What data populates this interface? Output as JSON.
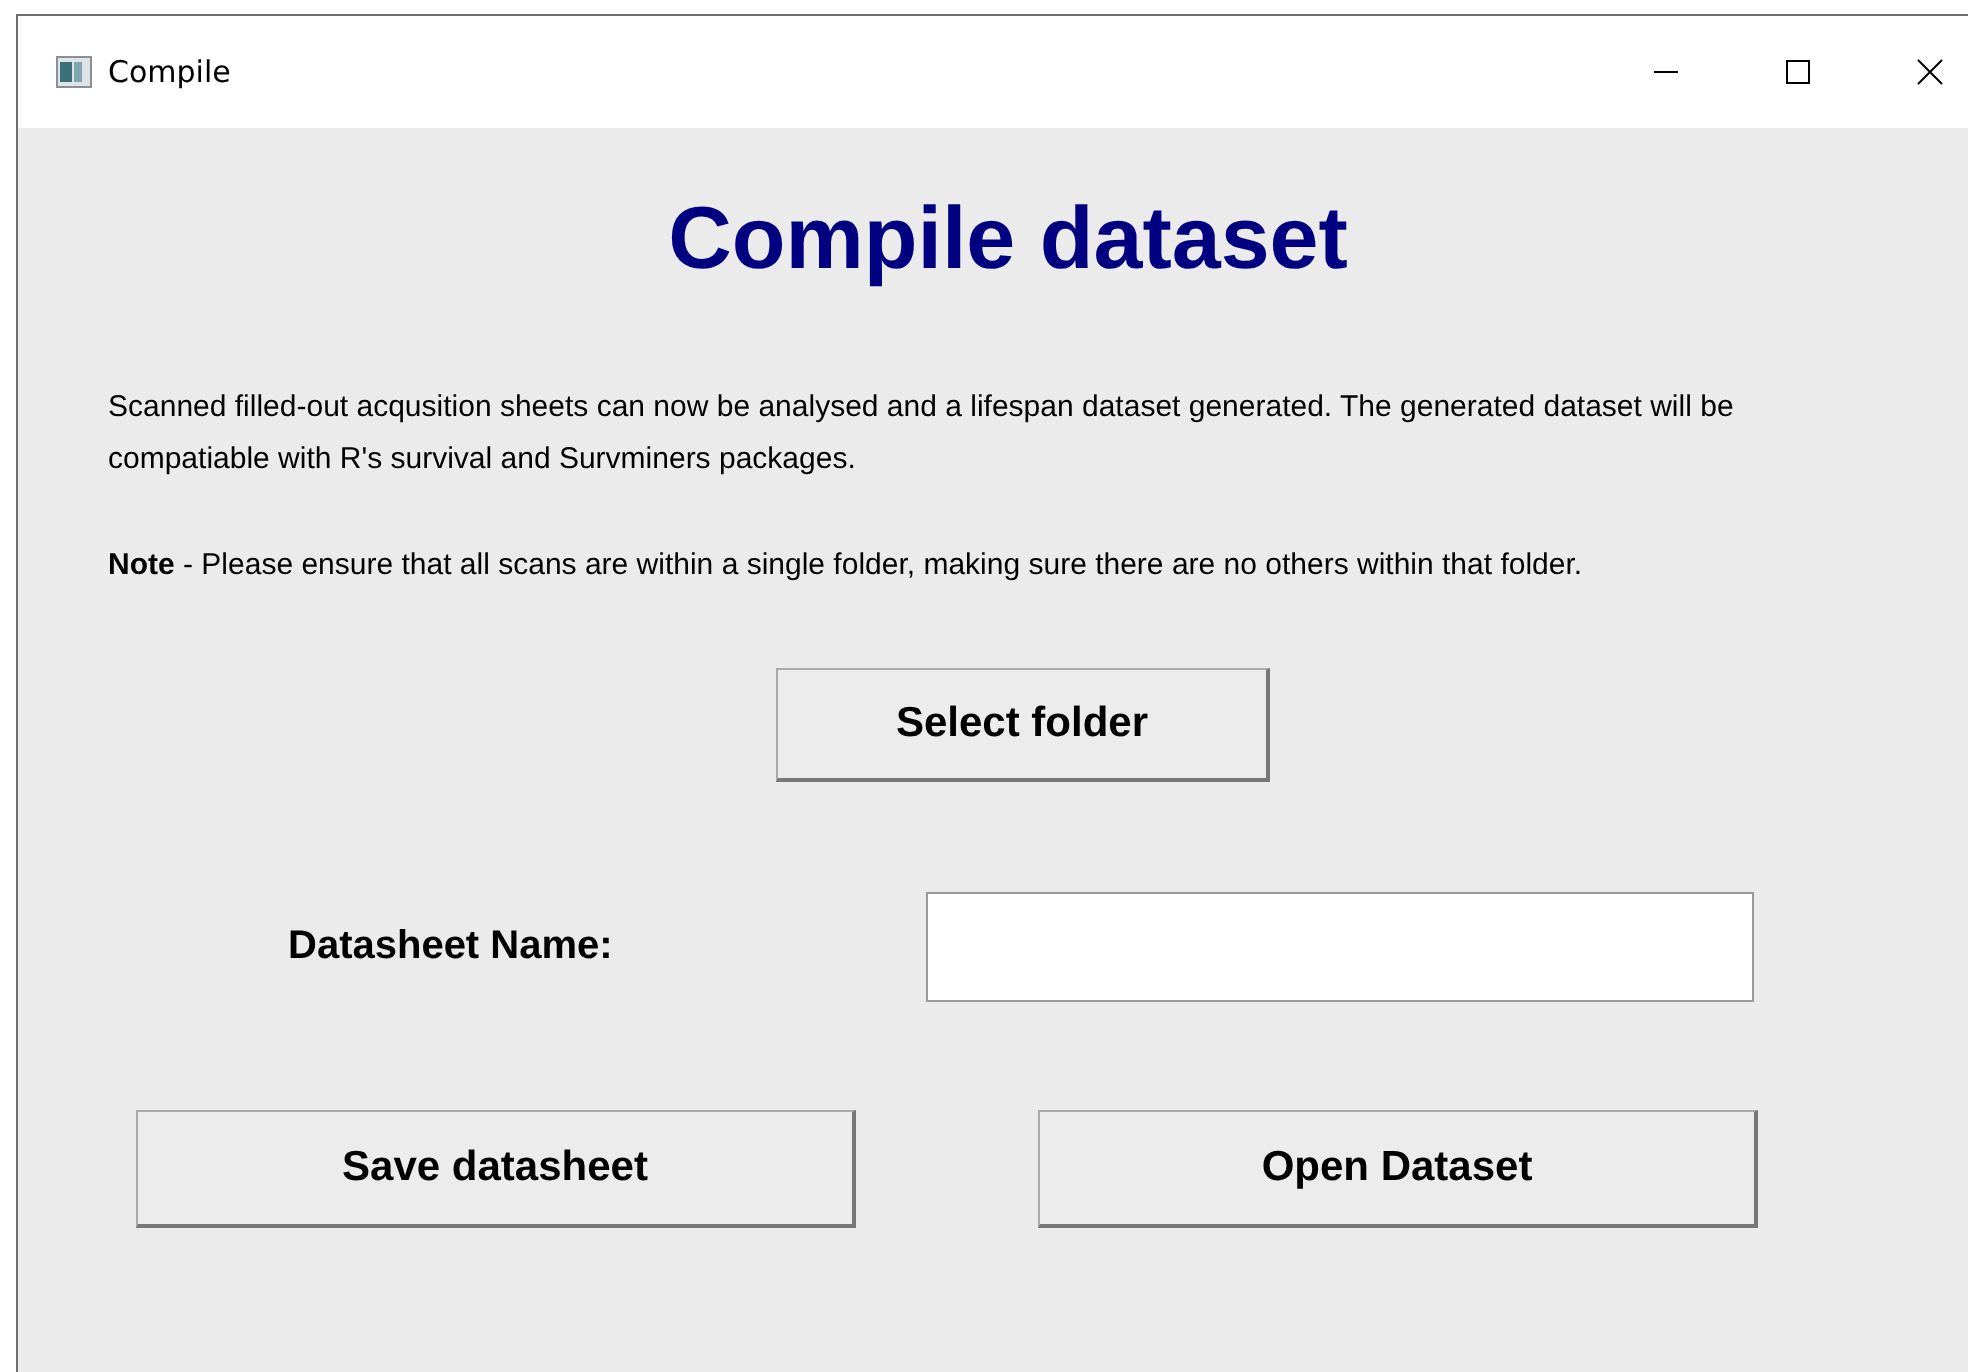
{
  "window": {
    "title": "Compile"
  },
  "heading": "Compile dataset",
  "paragraphs": [
    "Scanned filled-out acqusition sheets can now be analysed and a lifespan dataset generated. The generated dataset will be compatiable with R's survival and Survminers packages.",
    "**Note** - Please ensure that all scans are within a single folder, making sure there are no others within that folder."
  ],
  "select_button": "Select folder",
  "name_field": {
    "label": "Datasheet Name:"
  },
  "buttons": [
    "Save datasheet",
    "Open Dataset"
  ]
}
